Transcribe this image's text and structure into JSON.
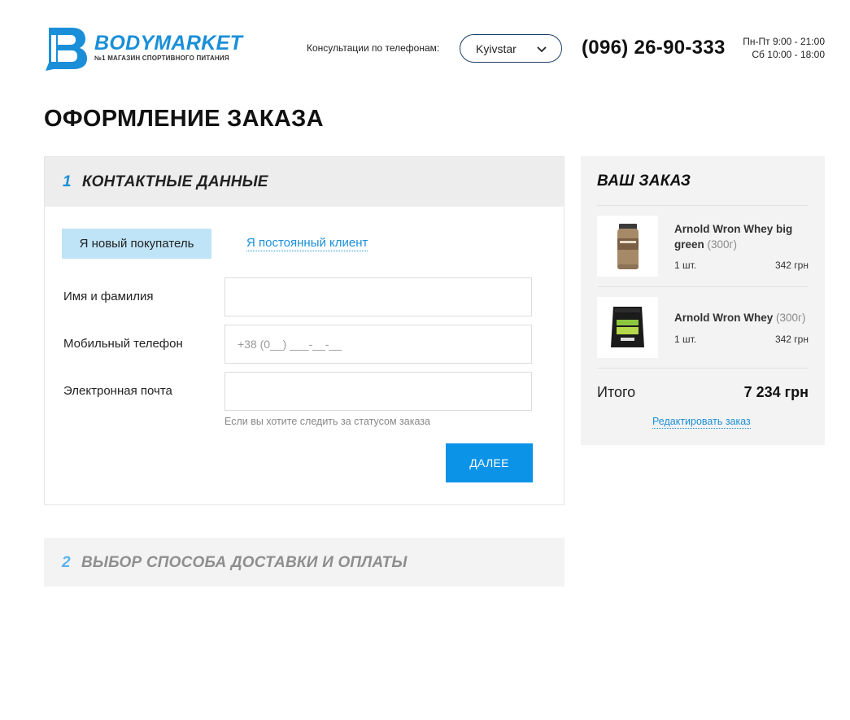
{
  "header": {
    "logo_name": "BODYMARKET",
    "logo_tagline": "№1 МАГАЗИН СПОРТИВНОГО ПИТАНИЯ",
    "consult_label": "Консультации по телефонам:",
    "operator_selected": "Kyivstar",
    "phone": "(096) 26-90-333",
    "hours_weekdays": "Пн-Пт 9:00 - 21:00",
    "hours_saturday": "Сб 10:00 - 18:00",
    "brand_color": "#1a8fd8"
  },
  "page_title": "ОФОРМЛЕНИЕ ЗАКАЗА",
  "step1": {
    "number": "1",
    "title": "КОНТАКТНЫЕ ДАННЫЕ",
    "tab_new": "Я новый покупатель",
    "tab_existing": "Я постоянный клиент",
    "fields": [
      {
        "label": "Имя и фамилия",
        "value": "",
        "placeholder": ""
      },
      {
        "label": "Мобильный телефон",
        "value": "",
        "placeholder": "+38 (0__) ___-__-__"
      },
      {
        "label": "Электронная почта",
        "value": "",
        "placeholder": ""
      }
    ],
    "email_hint": "Если вы хотите следить за статусом заказа",
    "next_button": "ДАЛЕЕ"
  },
  "step2": {
    "number": "2",
    "title": "ВЫБОР СПОСОБА ДОСТАВКИ И ОПЛАТЫ"
  },
  "order": {
    "title": "ВАШ ЗАКАЗ",
    "items": [
      {
        "name": "Arnold Wron Whey big green",
        "weight": "(300г)",
        "qty": "1 шт.",
        "price": "342 грн"
      },
      {
        "name": "Arnold Wron Whey",
        "weight": "(300г)",
        "qty": "1 шт.",
        "price": "342 грн"
      }
    ],
    "total_label": "Итого",
    "total_value": "7 234 грн",
    "edit_link": "Редактировать заказ"
  }
}
